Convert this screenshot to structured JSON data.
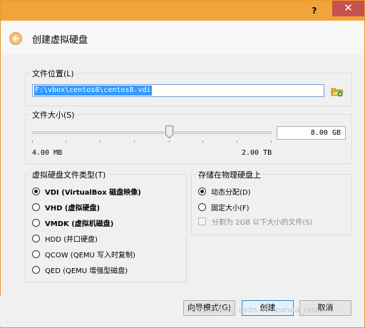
{
  "titlebar": {
    "help_label": "?",
    "close_label": "✕"
  },
  "header": {
    "title": "创建虚拟硬盘",
    "back_icon": "back-arrow-icon"
  },
  "location": {
    "label": "文件位置(L)",
    "value": "F:\\vbox\\centos8\\centos8.vdi",
    "folder_icon": "folder-icon"
  },
  "size": {
    "label": "文件大小(S)",
    "value": "8.00 GB",
    "min_label": "4.00 MB",
    "max_label": "2.00 TB",
    "slider_fraction": 0.58
  },
  "disk_type": {
    "label": "虚拟硬盘文件类型(T)",
    "selected": 0,
    "options": [
      "VDI (VirtualBox 磁盘映像)",
      "VHD (虚拟硬盘)",
      "VMDK (虚拟机磁盘)",
      "HDD (并口硬盘)",
      "QCOW (QEMU 写入时复制)",
      "QED (QEMU 增强型磁盘)"
    ]
  },
  "storage": {
    "label": "存储在物理硬盘上",
    "options": [
      "动态分配(D)",
      "固定大小(F)"
    ],
    "selected": 0,
    "split_label": "分割为 2GB 以下大小的文件(S)"
  },
  "buttons": {
    "guided": "向导模式(G)",
    "create": "创建",
    "cancel": "取消"
  },
  "watermark": "https://blog.csdn.net/panda_raster",
  "colors": {
    "titlebar": "#f2a43a",
    "close": "#c75050",
    "selection": "#3399ff"
  }
}
